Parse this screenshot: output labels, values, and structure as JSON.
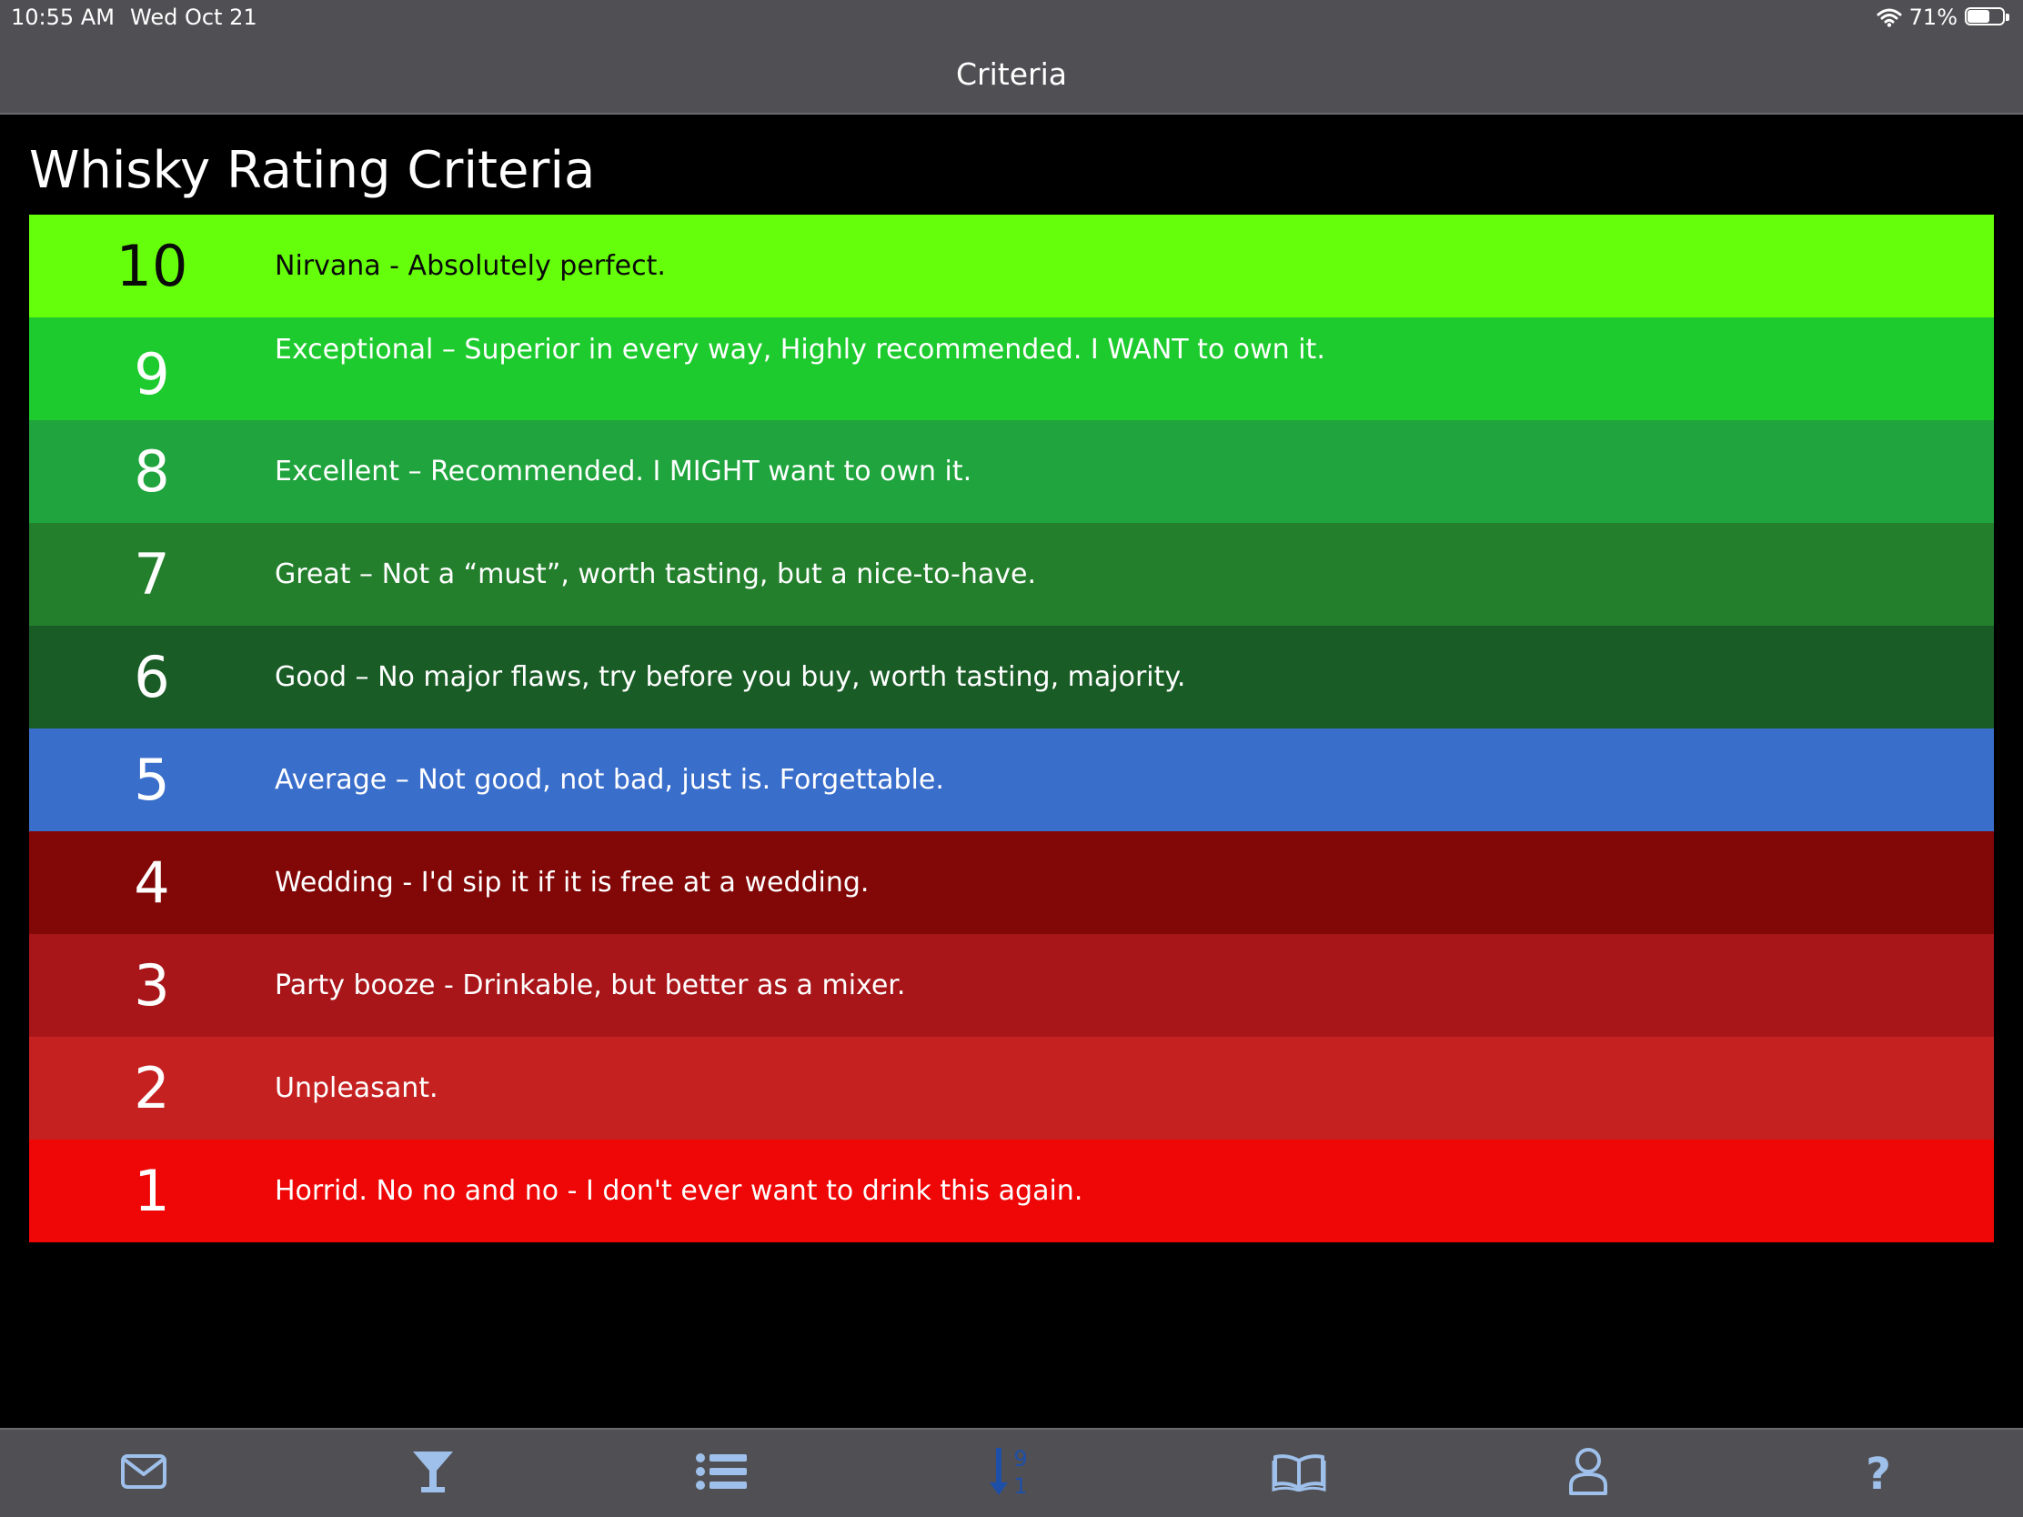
{
  "status_bar": {
    "time": "10:55 AM",
    "date": "Wed Oct 21",
    "battery_text": "71%",
    "battery_level": 0.71,
    "wifi_icon": "wifi-icon",
    "battery_icon": "battery-icon"
  },
  "nav": {
    "title": "Criteria"
  },
  "page": {
    "title": "Whisky Rating Criteria"
  },
  "criteria": [
    {
      "score": "10",
      "description": "Nirvana - Absolutely perfect.",
      "bg": "#66ff0b",
      "fg": "#0a0a0a"
    },
    {
      "score": "9",
      "description": "Exceptional – Superior in every way, Highly recommended.  I WANT to own it.",
      "bg": "#1ecb2e",
      "fg": "#ffffff"
    },
    {
      "score": "8",
      "description": "Excellent –  Recommended.  I MIGHT want to own it.",
      "bg": "#20a43d",
      "fg": "#ffffff"
    },
    {
      "score": "7",
      "description": "Great – Not a “must”, worth tasting, but a nice-to-have.",
      "bg": "#237f2c",
      "fg": "#ffffff"
    },
    {
      "score": "6",
      "description": "Good – No major flaws, try before you buy, worth tasting, majority.",
      "bg": "#195c26",
      "fg": "#ffffff"
    },
    {
      "score": "5",
      "description": "Average – Not good, not bad, just is.  Forgettable.",
      "bg": "#3a6ecb",
      "fg": "#ffffff"
    },
    {
      "score": "4",
      "description": "Wedding - I'd sip it if it is free at a wedding.",
      "bg": "#820707",
      "fg": "#ffffff"
    },
    {
      "score": "3",
      "description": "Party booze -  Drinkable, but better as a mixer.",
      "bg": "#a8161a",
      "fg": "#ffffff"
    },
    {
      "score": "2",
      "description": "Unpleasant.",
      "bg": "#c62121",
      "fg": "#ffffff"
    },
    {
      "score": "1",
      "description": "Horrid.  No no and no - I don't ever want to drink this again.",
      "bg": "#ee0706",
      "fg": "#ffffff"
    }
  ],
  "tab_bar": {
    "icons": [
      {
        "name": "envelope-icon"
      },
      {
        "name": "cocktail-glass-icon"
      },
      {
        "name": "list-icon"
      },
      {
        "name": "sort-descending-icon",
        "glyph_top": "9",
        "glyph_bottom": "1",
        "active": true
      },
      {
        "name": "open-book-icon"
      },
      {
        "name": "user-icon"
      },
      {
        "name": "question-mark-icon",
        "glyph": "?"
      }
    ],
    "icon_color": "#9ec0ea",
    "active_color": "#1e4fa8"
  }
}
